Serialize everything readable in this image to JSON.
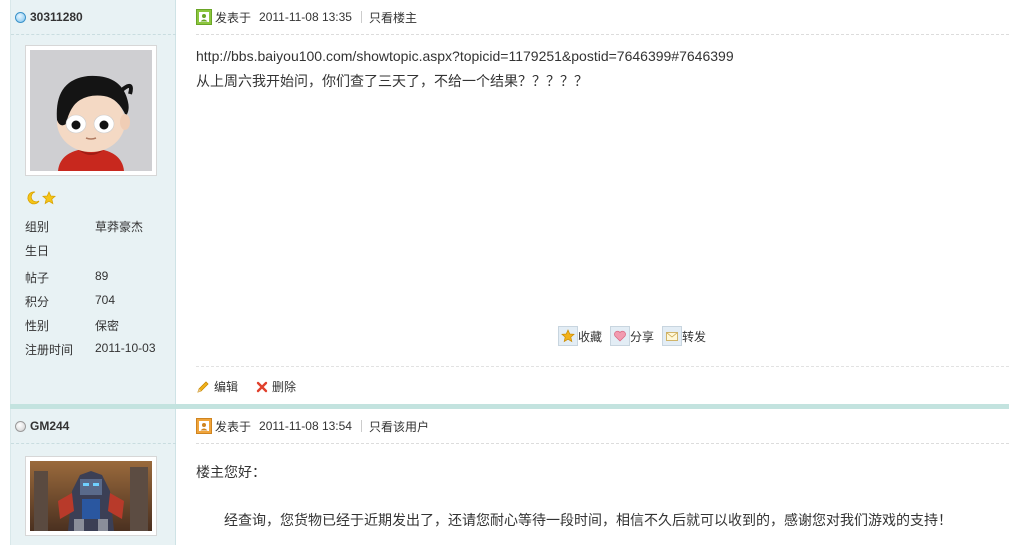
{
  "posts": [
    {
      "username": "30311280",
      "rank_icons": [
        "moon-icon",
        "star-icon"
      ],
      "profile": [
        {
          "label": "组别",
          "value": "草莽豪杰"
        },
        {
          "label": "生日",
          "value": ""
        },
        {
          "label": "帖子",
          "value": "89"
        },
        {
          "label": "积分",
          "value": "704"
        },
        {
          "label": "性别",
          "value": "保密"
        },
        {
          "label": "注册时间",
          "value": "2011-10-03"
        }
      ],
      "posted_label": "发表于",
      "date": "2011-11-08 13:35",
      "filter_link": "只看楼主",
      "content_url": "http://bbs.baiyou100.com/showtopic.aspx?topicid=1179251&postid=7646399#7646399",
      "content_text": "从上周六我开始问，你们查了三天了，不给一个结果？？？？？",
      "tools": {
        "favorite": "收藏",
        "share": "分享",
        "forward": "转发"
      },
      "actions": {
        "edit": "编辑",
        "delete": "删除"
      }
    },
    {
      "username": "GM244",
      "posted_label": "发表于",
      "date": "2011-11-08 13:54",
      "filter_link": "只看该用户",
      "greeting": "楼主您好：",
      "reply": "经查询，您货物已经于近期发出了，还请您耐心等待一段时间，相信不久后就可以收到的，感谢您对我们游戏的支持！"
    }
  ],
  "colors": {
    "sidebar_bg": "#e8f2f4",
    "divider": "#c3e3df",
    "post_icon_green": "#8cc63e",
    "post_icon_orange": "#f0a43a"
  }
}
